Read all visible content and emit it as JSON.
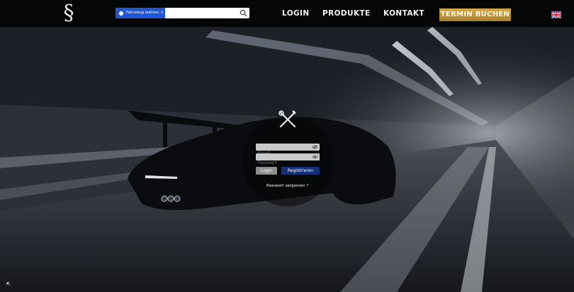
{
  "header": {
    "logo_glyph": "§",
    "search": {
      "vehicle_label": "Fahrzeug wählen",
      "vehicle_caret": "▾",
      "placeholder": ""
    },
    "nav": {
      "login": "LOGIN",
      "produkte": "PRODUKTE",
      "kontakt": "KONTAKT",
      "termin": "TERMIN BUCHEN"
    },
    "language_icon": "uk-flag-icon"
  },
  "login_form": {
    "email_placeholder": "Email",
    "password_placeholder": "Passwort",
    "login_label": "Login",
    "register_label": "Registrieren",
    "forgot_label": "Passwort vergessen ?"
  },
  "corner": {
    "glyph": "⇱"
  },
  "colors": {
    "accent_blue": "#1f57d6",
    "termin_gold": "#c39a3f",
    "register_blue": "#143079",
    "login_gray": "#8e8e8e"
  }
}
